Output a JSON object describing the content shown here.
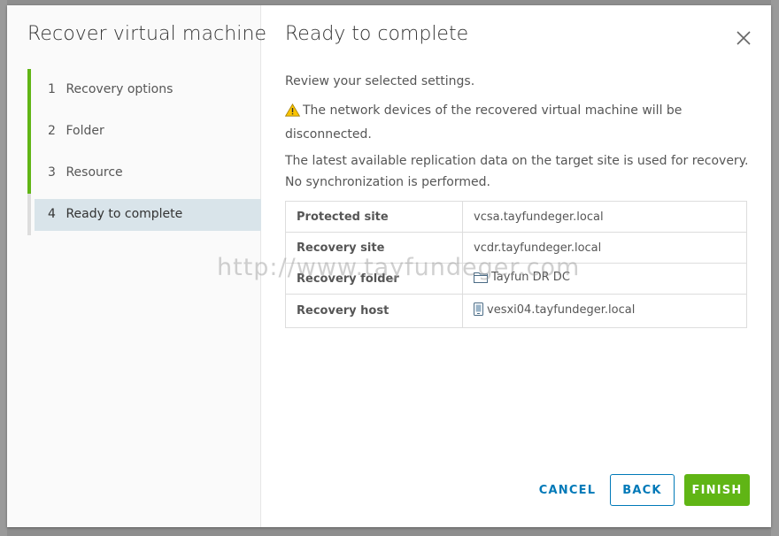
{
  "wizard": {
    "title": "Recover virtual machine",
    "steps": [
      {
        "num": "1",
        "label": "Recovery options"
      },
      {
        "num": "2",
        "label": "Folder"
      },
      {
        "num": "3",
        "label": "Resource"
      },
      {
        "num": "4",
        "label": "Ready to complete"
      }
    ],
    "active_step": 4,
    "step_complete_color": "#60b515"
  },
  "page": {
    "title": "Ready to complete",
    "intro": "Review your selected settings.",
    "warning": "The network devices of the recovered virtual machine will be disconnected.",
    "info": "The latest available replication data on the target site is used for recovery. No synchronization is performed.",
    "summary": [
      {
        "label": "Protected site",
        "value": "vcsa.tayfundeger.local",
        "icon": ""
      },
      {
        "label": "Recovery site",
        "value": "vcdr.tayfundeger.local",
        "icon": ""
      },
      {
        "label": "Recovery folder",
        "value": "Tayfun DR DC",
        "icon": "folder-icon"
      },
      {
        "label": "Recovery host",
        "value": "vesxi04.tayfundeger.local",
        "icon": "host-icon"
      }
    ]
  },
  "watermark": "http://www.tayfundeger.com",
  "footer": {
    "cancel_label": "CANCEL",
    "back_label": "BACK",
    "finish_label": "FINISH"
  },
  "colors": {
    "primary": "#0079b8",
    "success": "#60b515",
    "warning": "#fac400",
    "active_step_bg": "#d9e4ea"
  }
}
